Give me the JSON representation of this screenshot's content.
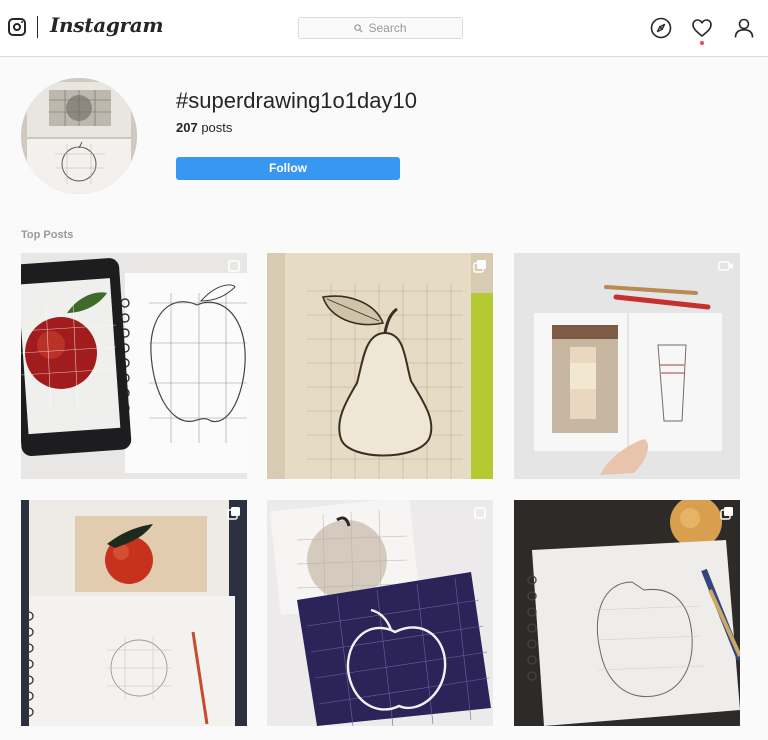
{
  "header": {
    "brand": "Instagram",
    "search_placeholder": "Search",
    "icons": [
      "instagram-glyph-icon",
      "explore-compass-icon",
      "activity-heart-icon",
      "profile-icon"
    ],
    "notification_color": "#ed4956"
  },
  "profile": {
    "hashtag": "#superdrawing1o1day10",
    "posts_count": "207",
    "posts_label": " posts",
    "follow_label": "Follow",
    "accent_color": "#3897f0"
  },
  "section": {
    "top_posts_label": "Top Posts"
  },
  "posts": [
    {
      "badge": "square-icon"
    },
    {
      "badge": "carousel-icon"
    },
    {
      "badge": "video-camera-icon"
    },
    {
      "badge": "carousel-icon"
    },
    {
      "badge": "square-icon"
    },
    {
      "badge": "carousel-icon"
    }
  ]
}
